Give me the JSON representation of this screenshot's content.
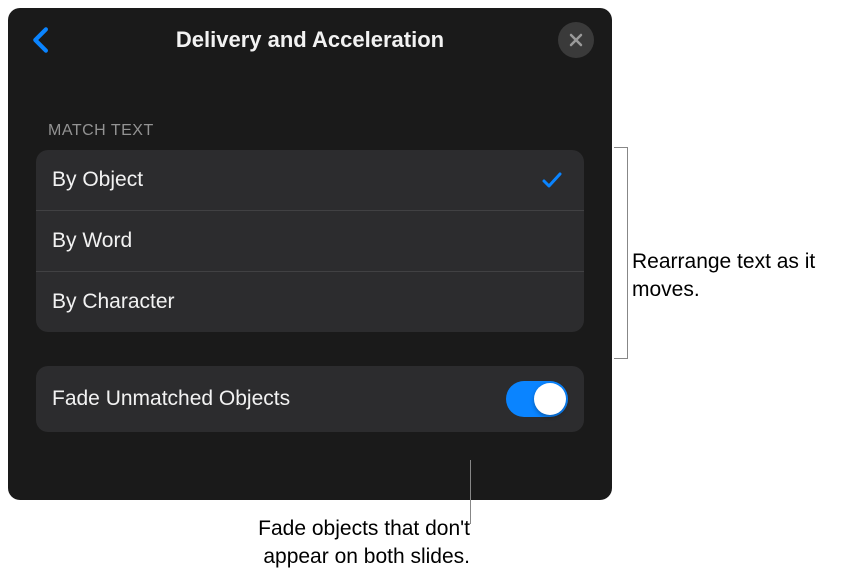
{
  "header": {
    "title": "Delivery and Acceleration"
  },
  "section": {
    "header": "MATCH TEXT",
    "options": [
      {
        "label": "By Object",
        "selected": true
      },
      {
        "label": "By Word",
        "selected": false
      },
      {
        "label": "By Character",
        "selected": false
      }
    ]
  },
  "toggle": {
    "label": "Fade Unmatched Objects",
    "on": true
  },
  "callouts": {
    "right": "Rearrange text as it moves.",
    "bottom": "Fade objects that don't appear on both slides."
  }
}
